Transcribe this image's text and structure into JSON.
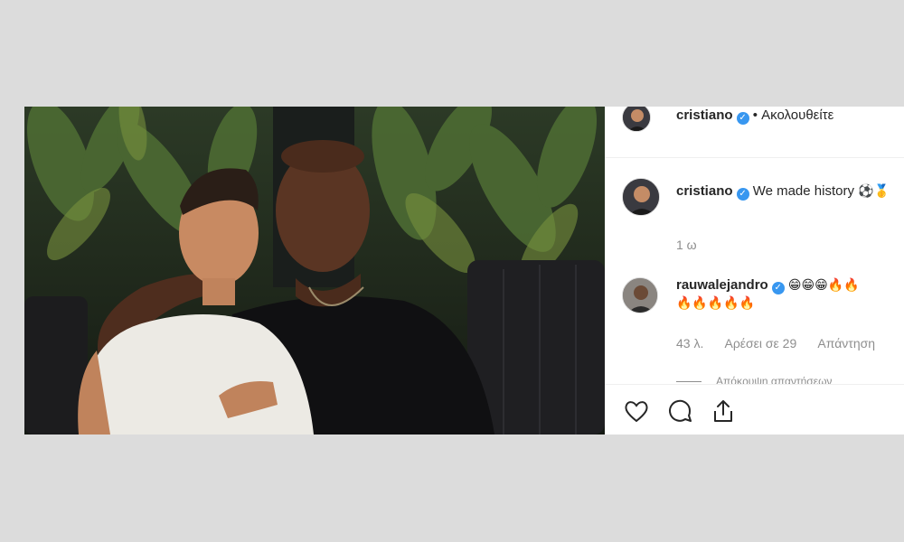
{
  "post": {
    "author": "cristiano",
    "follow_status": "• Ακολουθείτε",
    "photo_alt": "cristiano-and-friend-photo"
  },
  "caption": {
    "username": "cristiano",
    "text": "We made history",
    "emojis": "⚽🥇",
    "time": "1 ω"
  },
  "reply": {
    "username": "rauwalejandro",
    "emojis_line1": "😁😁😁🔥🔥",
    "emojis_line2": "🔥🔥🔥🔥🔥",
    "time": "43 λ.",
    "likes": "Αρέσει σε 29",
    "reply_label": "Απάντηση",
    "view_replies": "Απόκρυψη απαντήσεων"
  },
  "actions": {
    "like_icon": "heart-icon",
    "comment_icon": "comment-icon",
    "share_icon": "share-icon"
  },
  "colors": {
    "verified": "#3897f0",
    "text": "#262626",
    "muted": "#8e8e8e",
    "background": "#dcdcdc"
  }
}
